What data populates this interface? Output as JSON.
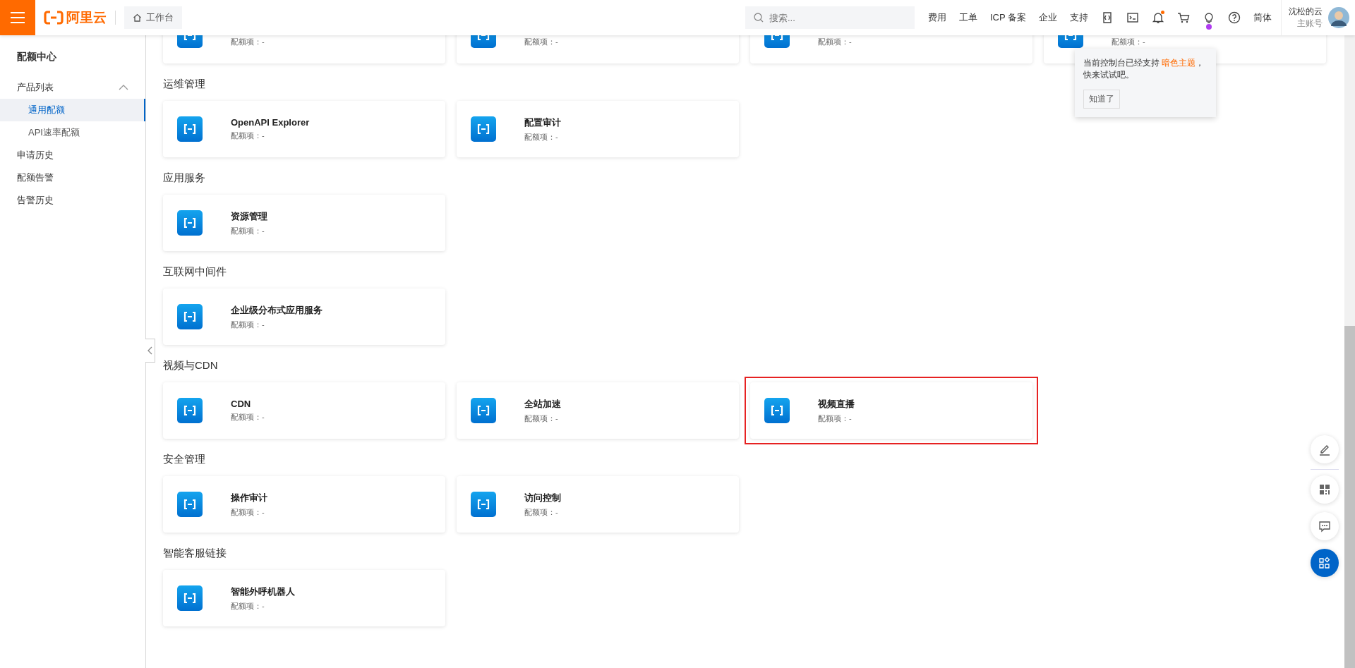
{
  "header": {
    "brand": "阿里云",
    "workbench": "工作台",
    "search": {
      "placeholder": "搜索..."
    },
    "nav": [
      "费用",
      "工单",
      "ICP 备案",
      "企业",
      "支持"
    ],
    "icons": [
      {
        "kind": "api",
        "badge": false
      },
      {
        "kind": "terminal",
        "badge": false
      },
      {
        "kind": "bell",
        "badge": true
      },
      {
        "kind": "cart",
        "badge": false
      },
      {
        "kind": "bulb",
        "badge": true
      }
    ],
    "help": true,
    "language": "简体",
    "user": {
      "name": "沈松的云",
      "role": "主账号"
    }
  },
  "sidebar": {
    "title": "配额中心",
    "items": [
      {
        "label": "产品列表",
        "expanded": true,
        "selected": false,
        "children": [
          {
            "label": "通用配额",
            "selected": true
          },
          {
            "label": "API速率配额",
            "selected": false
          }
        ]
      },
      {
        "label": "申请历史",
        "selected": false
      },
      {
        "label": "配额告警",
        "selected": false
      },
      {
        "label": "告警历史",
        "selected": false
      }
    ]
  },
  "sections": [
    {
      "cards": [
        {
          "quota": "配额项：-",
          "highlighted": false
        },
        {
          "quota": "配额项：-",
          "highlighted": false
        },
        {
          "quota": "配额项：-",
          "highlighted": false
        },
        {
          "quota": "配额项：-",
          "highlighted": false
        }
      ]
    },
    {
      "title": "运维管理",
      "cards": [
        {
          "name": "OpenAPI Explorer",
          "quota": "配额项：-",
          "highlighted": false
        },
        {
          "name": "配置审计",
          "quota": "配额项：-",
          "highlighted": false
        }
      ]
    },
    {
      "title": "应用服务",
      "cards": [
        {
          "name": "资源管理",
          "quota": "配额项：-",
          "highlighted": false
        }
      ]
    },
    {
      "title": "互联网中间件",
      "cards": [
        {
          "name": "企业级分布式应用服务",
          "quota": "配额项：-",
          "highlighted": false
        }
      ]
    },
    {
      "title": "视频与CDN",
      "cards": [
        {
          "name": "CDN",
          "quota": "配额项：-",
          "highlighted": false
        },
        {
          "name": "全站加速",
          "quota": "配额项：-",
          "highlighted": false
        },
        {
          "name": "视频直播",
          "quota": "配额项：-",
          "highlighted": true
        }
      ]
    },
    {
      "title": "安全管理",
      "cards": [
        {
          "name": "操作审计",
          "quota": "配额项：-",
          "highlighted": false
        },
        {
          "name": "访问控制",
          "quota": "配额项：-",
          "highlighted": false
        }
      ]
    },
    {
      "title": "智能客服链接",
      "cards": [
        {
          "name": "智能外呼机器人",
          "quota": "配额项：-",
          "highlighted": false
        }
      ]
    }
  ],
  "tooltip": {
    "before": "当前控制台已经支持 ",
    "link": "暗色主题",
    "after": "，快来试试吧。",
    "button": "知道了"
  },
  "float_buttons": [
    {
      "kind": "edit"
    },
    {
      "kind": "qr"
    },
    {
      "kind": "chat"
    },
    {
      "kind": "apps"
    }
  ]
}
